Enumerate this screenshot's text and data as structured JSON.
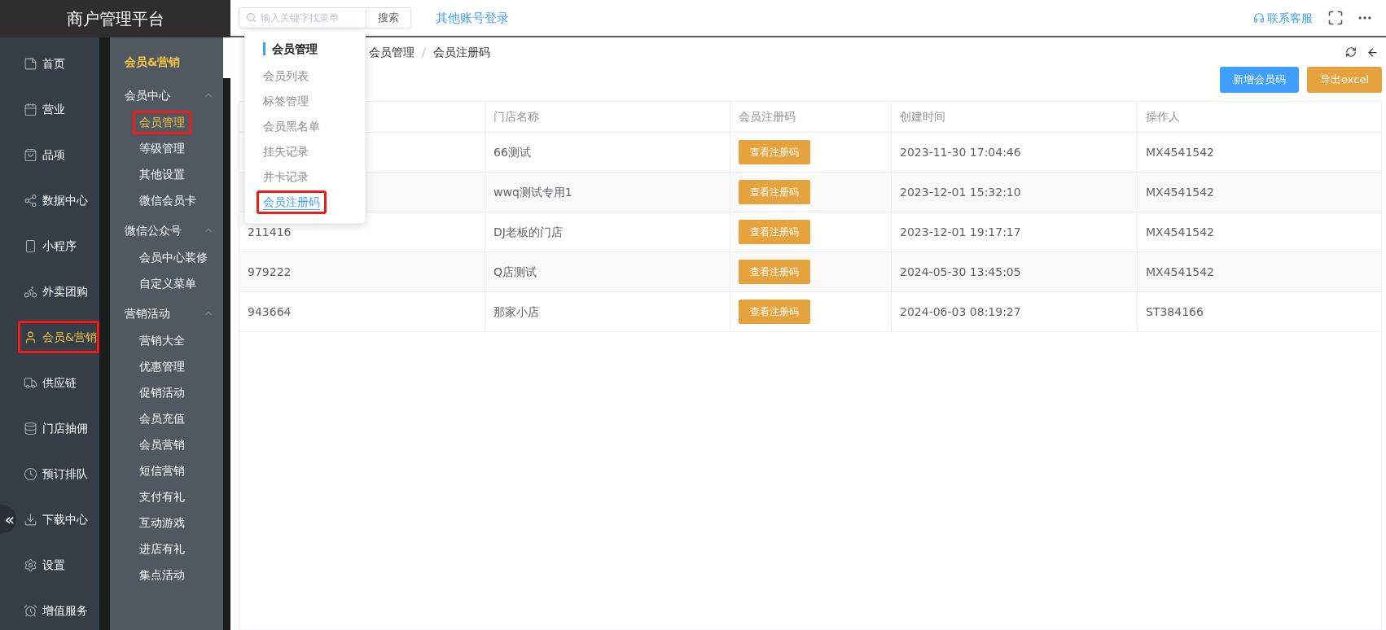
{
  "app_title": "商户管理平台",
  "nav": [
    {
      "label": "首页",
      "selected": false
    },
    {
      "label": "营业",
      "selected": false
    },
    {
      "label": "品项",
      "selected": false
    },
    {
      "label": "数据中心",
      "selected": false
    },
    {
      "label": "小程序",
      "selected": false
    },
    {
      "label": "外卖团购",
      "selected": false
    },
    {
      "label": "会员&营销",
      "selected": true
    },
    {
      "label": "供应链",
      "selected": false
    },
    {
      "label": "门店抽佣",
      "selected": false
    },
    {
      "label": "预订排队",
      "selected": false
    },
    {
      "label": "下载中心",
      "selected": false
    },
    {
      "label": "设置",
      "selected": false
    },
    {
      "label": "增值服务",
      "selected": false
    }
  ],
  "collapse_button": "«",
  "submenu": {
    "title": "会员&营销",
    "groups": [
      {
        "label": "会员中心",
        "expanded": true,
        "items": [
          {
            "label": "会员管理",
            "selected": true
          },
          {
            "label": "等级管理",
            "selected": false
          },
          {
            "label": "其他设置",
            "selected": false
          },
          {
            "label": "微信会员卡",
            "selected": false
          }
        ]
      },
      {
        "label": "微信公众号",
        "expanded": true,
        "items": [
          {
            "label": "会员中心装修",
            "selected": false
          },
          {
            "label": "自定义菜单",
            "selected": false
          }
        ]
      },
      {
        "label": "营销活动",
        "expanded": true,
        "items": [
          {
            "label": "营销大全",
            "selected": false
          },
          {
            "label": "优惠管理",
            "selected": false
          },
          {
            "label": "促销活动",
            "selected": false
          },
          {
            "label": "会员充值",
            "selected": false
          },
          {
            "label": "会员营销",
            "selected": false
          },
          {
            "label": "短信营销",
            "selected": false
          },
          {
            "label": "支付有礼",
            "selected": false
          },
          {
            "label": "互动游戏",
            "selected": false
          },
          {
            "label": "进店有礼",
            "selected": false
          },
          {
            "label": "集点活动",
            "selected": false
          }
        ]
      }
    ]
  },
  "topbar": {
    "search": {
      "placeholder": "输入关键字找菜单",
      "button": "搜索"
    },
    "other_login": "其他账号登录",
    "support": "联系客服"
  },
  "breadcrumb": [
    "会员管理",
    "会员注册码"
  ],
  "breadcrumb_separator": "/",
  "actions": [
    {
      "label": "新增会员码",
      "kind": "primary"
    },
    {
      "label": "导出excel",
      "kind": "warning"
    }
  ],
  "table": {
    "columns": [
      "门店名称",
      "会员注册码",
      "创建时间",
      "操作人"
    ],
    "rows": [
      {
        "store": "66测试",
        "action": "查看注册码",
        "created": "2023-11-30 17:04:46",
        "operator": "MX4541542"
      },
      {
        "store": "wwq测试专用1",
        "action": "查看注册码",
        "created": "2023-12-01 15:32:10",
        "operator": "MX4541542"
      },
      {
        "code": "211416",
        "store": "DJ老板的门店",
        "action": "查看注册码",
        "created": "2023-12-01 19:17:17",
        "operator": "MX4541542"
      },
      {
        "code": "979222",
        "store": "Q店测试",
        "action": "查看注册码",
        "created": "2024-05-30 13:45:05",
        "operator": "MX4541542"
      },
      {
        "code": "943664",
        "store": "那家小店",
        "action": "查看注册码",
        "created": "2024-06-03 08:19:27",
        "operator": "ST384166"
      }
    ]
  },
  "popup": {
    "title": "会员管理",
    "items": [
      {
        "label": "会员列表",
        "selected": false
      },
      {
        "label": "标签管理",
        "selected": false
      },
      {
        "label": "会员黑名单",
        "selected": false
      },
      {
        "label": "挂失记录",
        "selected": false
      },
      {
        "label": "并卡记录",
        "selected": false
      },
      {
        "label": "会员注册码",
        "selected": true
      }
    ]
  }
}
